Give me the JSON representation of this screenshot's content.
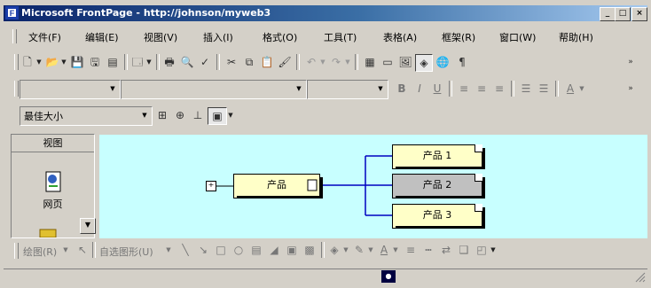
{
  "window": {
    "title": "Microsoft FrontPage - http://johnson/myweb3"
  },
  "menu": [
    "文件(F)",
    "编辑(E)",
    "视图(V)",
    "插入(I)",
    "格式(O)",
    "工具(T)",
    "表格(A)",
    "框架(R)",
    "窗口(W)",
    "帮助(H)"
  ],
  "format_bar": {
    "zoom_value": "最佳大小"
  },
  "views_bar": {
    "title": "视图",
    "item_label": "网页"
  },
  "canvas": {
    "root_node": "产品",
    "children": [
      "产品 1",
      "产品 2",
      "产品 3"
    ],
    "selected_child": "产品 2",
    "expand_glyph": "+"
  },
  "drawing_toolbar": {
    "draw_label": "绘图(R)",
    "autoshapes_label": "自选图形(U)"
  },
  "colors": {
    "canvas_bg": "#c8ffff",
    "node_bg": "#ffffc8",
    "selected_node_bg": "#c0c0c0",
    "connector": "#0000c0"
  }
}
